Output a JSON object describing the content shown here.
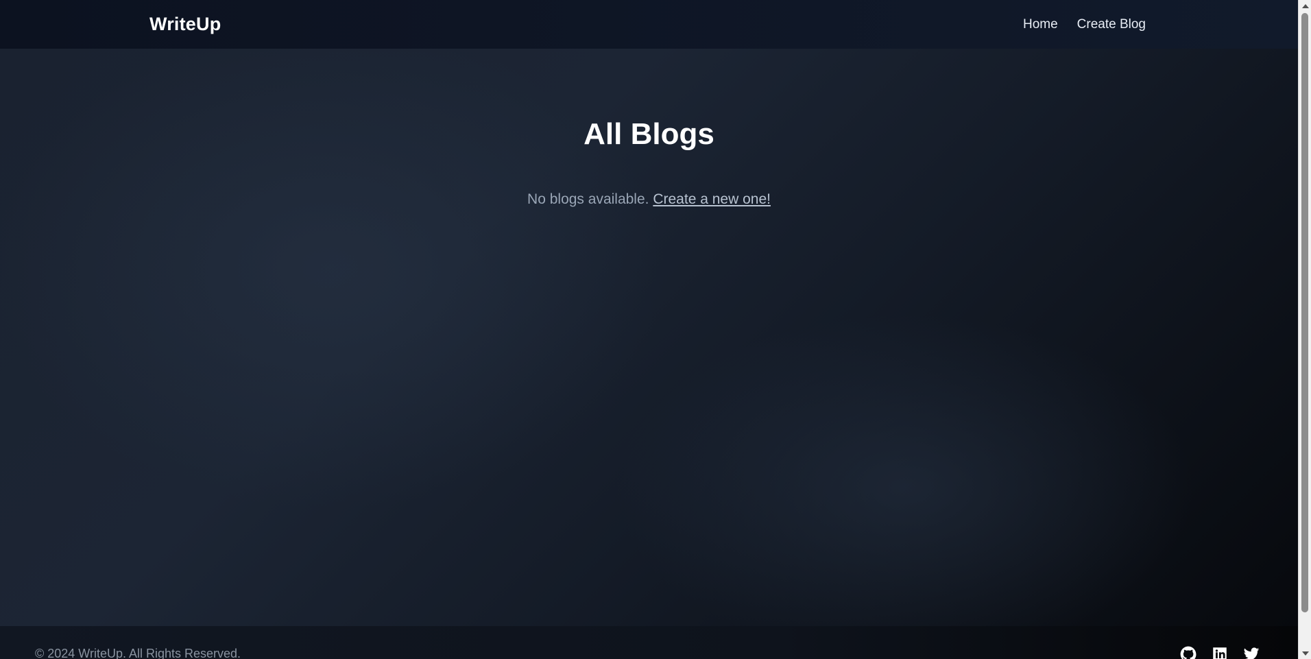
{
  "navbar": {
    "brand": "WriteUp",
    "links": [
      {
        "label": "Home"
      },
      {
        "label": "Create Blog"
      }
    ]
  },
  "main": {
    "title": "All Blogs",
    "empty_text": "No blogs available.",
    "empty_link": "Create a new one!"
  },
  "footer": {
    "copyright": "© 2024 WriteUp. All Rights Reserved.",
    "social_icons": [
      "github-icon",
      "linkedin-icon",
      "twitter-icon"
    ]
  },
  "colors": {
    "navbar_bg": "#0c1220",
    "page_bg": "#1c2534",
    "text_primary": "#ffffff",
    "text_muted": "#9aa6b6"
  }
}
